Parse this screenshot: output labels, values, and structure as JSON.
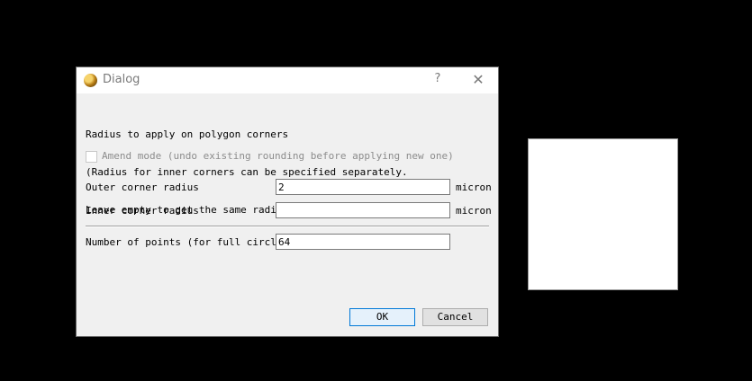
{
  "dialog": {
    "title": "Dialog",
    "help_glyph": "?",
    "close_glyph": "✕",
    "app_icon": "klayout-app-icon",
    "description_lines": [
      "Radius to apply on polygon corners",
      "(Radius for inner corners can be specified separately.",
      "Leave empty to get the same radius than for outer corners)"
    ],
    "amend": {
      "label": "Amend mode (undo existing rounding before applying new one)",
      "checked": false,
      "enabled": false
    },
    "outer_radius": {
      "label": "Outer corner radius",
      "value": "2",
      "unit": "micron"
    },
    "inner_radius": {
      "label": "Inner corner radius",
      "value": "",
      "unit": "micron"
    },
    "points": {
      "label": "Number of points (for full circle)",
      "value": "64"
    },
    "buttons": {
      "ok": "OK",
      "cancel": "Cancel"
    }
  },
  "colors": {
    "background": "#000000",
    "dialog_bg": "#f0f0f0",
    "ok_border": "#0078d7"
  }
}
